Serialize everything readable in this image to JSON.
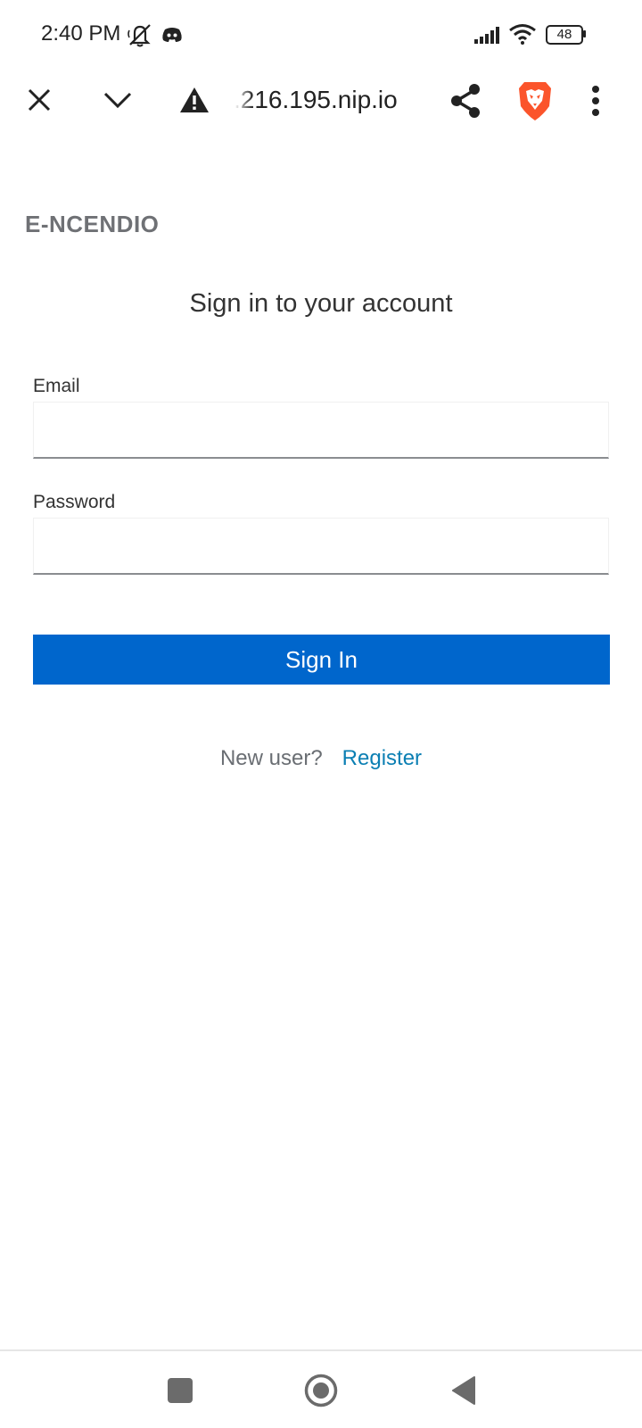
{
  "status_bar": {
    "time": "2:40 PM",
    "icons": [
      "muted-icon",
      "discord-icon",
      "signal-icon",
      "wifi-icon",
      "battery-icon"
    ],
    "battery": "48"
  },
  "toolbar": {
    "url": ".216.195.nip.io",
    "icons": [
      "close-icon",
      "chevron-down-icon",
      "warning-icon",
      "share-icon",
      "brave-icon",
      "more-icon"
    ]
  },
  "page": {
    "brand": "E-NCENDIO",
    "heading": "Sign in to your account",
    "email_label": "Email",
    "email_value": "",
    "password_label": "Password",
    "password_value": "",
    "signin_label": "Sign In",
    "new_user_text": "New user?",
    "register_label": "Register"
  },
  "nav_bar": {
    "icons": [
      "recents-icon",
      "home-icon",
      "back-icon"
    ]
  },
  "colors": {
    "primary": "#0066cc",
    "link": "#0b7fb3",
    "brand_text": "#6f7175",
    "brave_orange": "#fb542b"
  }
}
